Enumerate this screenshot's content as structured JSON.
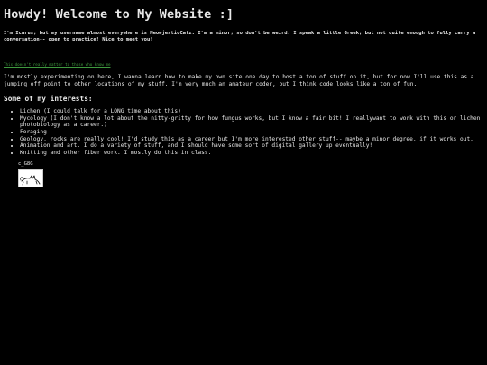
{
  "page": {
    "title": "Howdy! Welcome to My Website :]",
    "intro": "I'm Icarus, but my username almost everywhere is MeowjesticCatz. I'm a minor, so don't be weird. I speak a little Greek, but not quite enough to fully carry a conversation-- open to practice! Nice to meet you!",
    "secret_link": "This doesn't really matter to those who know me",
    "about": "I'm mostly experimenting on here, I wanna learn how to make my own site one day to host a ton of stuff on it, but for now I'll use this as a jumping off point to other locations of my stuff. I'm very much an amateur coder, but I think code looks like a ton of fun.",
    "interests_heading": "Some of my interests:",
    "interests": [
      "Lichen (I could talk for a LONG time about this)",
      "Mycology (I don't know a lot about the nitty-gritty for how fungus works, but I know a fair bit! I reallywant to work with this or lichen photobiology as a career.)",
      "Foraging",
      "Geology, rocks are really cool! I'd study this as a career but I'm more interested other stuff-- maybe a minor degree, if it works out.",
      "Animation and art. I do a variety of stuff, and I should have some sort of digital gallery up eventually!",
      "Knitting and other fiber work. I mostly do this in class."
    ],
    "signoff": "c_G8G",
    "doodle_icon": "cat-doodle-icon"
  },
  "colors": {
    "background": "#000000",
    "text": "#e8e8e8",
    "link": "#3f9a3f"
  }
}
